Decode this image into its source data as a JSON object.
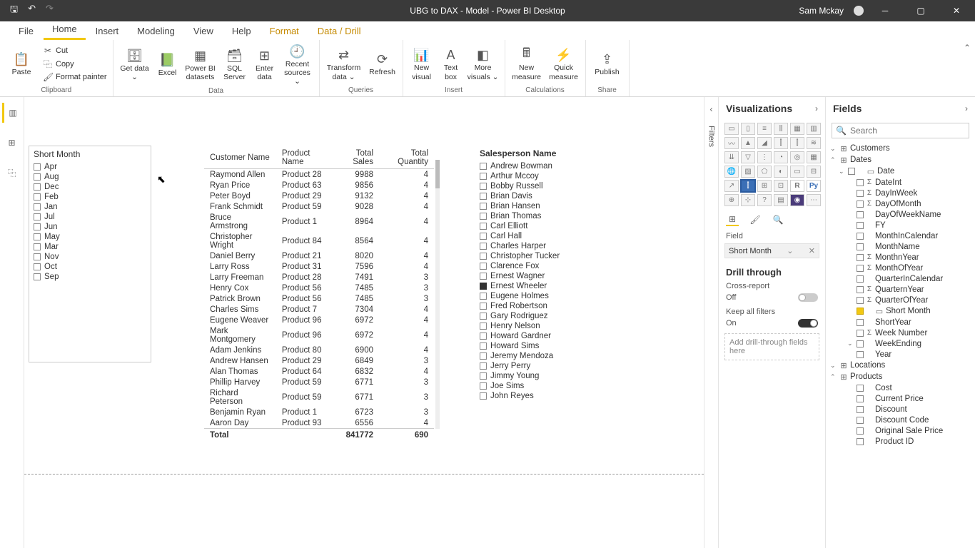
{
  "titlebar": {
    "title": "UBG to DAX - Model - Power BI Desktop",
    "user": "Sam Mckay"
  },
  "menu": {
    "file": "File",
    "home": "Home",
    "insert": "Insert",
    "modeling": "Modeling",
    "view": "View",
    "help": "Help",
    "format": "Format",
    "datadrill": "Data / Drill"
  },
  "ribbon": {
    "clipboard": {
      "label": "Clipboard",
      "paste": "Paste",
      "cut": "Cut",
      "copy": "Copy",
      "painter": "Format painter"
    },
    "data": {
      "label": "Data",
      "getdata": "Get data ⌄",
      "excel": "Excel",
      "pbids": "Power BI datasets",
      "sql": "SQL Server",
      "enter": "Enter data",
      "recent": "Recent sources ⌄"
    },
    "queries": {
      "label": "Queries",
      "transform": "Transform data ⌄",
      "refresh": "Refresh"
    },
    "insert": {
      "label": "Insert",
      "newvisual": "New visual",
      "textbox": "Text box",
      "more": "More visuals ⌄"
    },
    "calc": {
      "label": "Calculations",
      "newmeasure": "New measure",
      "quick": "Quick measure"
    },
    "share": {
      "label": "Share",
      "publish": "Publish"
    }
  },
  "slicer_months": {
    "title": "Short Month",
    "items": [
      "Apr",
      "Aug",
      "Dec",
      "Feb",
      "Jan",
      "Jul",
      "Jun",
      "May",
      "Mar",
      "Nov",
      "Oct",
      "Sep"
    ]
  },
  "table": {
    "cols": [
      "Customer Name",
      "Product Name",
      "Total Sales",
      "Total Quantity"
    ],
    "rows": [
      [
        "Raymond Allen",
        "Product 28",
        "9988",
        "4"
      ],
      [
        "Ryan Price",
        "Product 63",
        "9856",
        "4"
      ],
      [
        "Peter Boyd",
        "Product 29",
        "9132",
        "4"
      ],
      [
        "Frank Schmidt",
        "Product 59",
        "9028",
        "4"
      ],
      [
        "Bruce Armstrong",
        "Product 1",
        "8964",
        "4"
      ],
      [
        "Christopher Wright",
        "Product 84",
        "8564",
        "4"
      ],
      [
        "Daniel Berry",
        "Product 21",
        "8020",
        "4"
      ],
      [
        "Larry Ross",
        "Product 31",
        "7596",
        "4"
      ],
      [
        "Larry Freeman",
        "Product 28",
        "7491",
        "3"
      ],
      [
        "Henry Cox",
        "Product 56",
        "7485",
        "3"
      ],
      [
        "Patrick Brown",
        "Product 56",
        "7485",
        "3"
      ],
      [
        "Charles Sims",
        "Product 7",
        "7304",
        "4"
      ],
      [
        "Eugene Weaver",
        "Product 96",
        "6972",
        "4"
      ],
      [
        "Mark Montgomery",
        "Product 96",
        "6972",
        "4"
      ],
      [
        "Adam Jenkins",
        "Product 80",
        "6900",
        "4"
      ],
      [
        "Andrew Hansen",
        "Product 29",
        "6849",
        "3"
      ],
      [
        "Alan Thomas",
        "Product 64",
        "6832",
        "4"
      ],
      [
        "Phillip Harvey",
        "Product 59",
        "6771",
        "3"
      ],
      [
        "Richard Peterson",
        "Product 59",
        "6771",
        "3"
      ],
      [
        "Benjamin Ryan",
        "Product 1",
        "6723",
        "3"
      ],
      [
        "Aaron Day",
        "Product 93",
        "6556",
        "4"
      ]
    ],
    "total_label": "Total",
    "total_sales": "841772",
    "total_qty": "690"
  },
  "slicer_sales": {
    "title": "Salesperson Name",
    "items": [
      "Andrew Bowman",
      "Arthur Mccoy",
      "Bobby Russell",
      "Brian Davis",
      "Brian Hansen",
      "Brian Thomas",
      "Carl Elliott",
      "Carl Hall",
      "Charles Harper",
      "Christopher Tucker",
      "Clarence Fox",
      "Ernest Wagner",
      "Ernest Wheeler",
      "Eugene Holmes",
      "Fred Robertson",
      "Gary Rodriguez",
      "Henry Nelson",
      "Howard Gardner",
      "Howard Sims",
      "Jeremy Mendoza",
      "Jerry Perry",
      "Jimmy Young",
      "Joe Sims",
      "John Reyes"
    ],
    "selected_index": 12
  },
  "filters_label": "Filters",
  "viz": {
    "title": "Visualizations",
    "field_label": "Field",
    "field_value": "Short Month",
    "drill_title": "Drill through",
    "cross": "Cross-report",
    "off": "Off",
    "keep": "Keep all filters",
    "on": "On",
    "drill_well": "Add drill-through fields here"
  },
  "fields": {
    "title": "Fields",
    "search": "Search",
    "tables": {
      "customers": "Customers",
      "dates": "Dates",
      "date": "Date",
      "locations": "Locations",
      "products": "Products"
    },
    "date_fields": [
      "DateInt",
      "DayInWeek",
      "DayOfMonth",
      "DayOfWeekName",
      "FY",
      "MonthInCalendar",
      "MonthName",
      "MonthnYear",
      "MonthOfYear",
      "QuarterInCalendar",
      "QuarternYear",
      "QuarterOfYear",
      "Short Month",
      "ShortYear",
      "Week Number",
      "WeekEnding",
      "Year"
    ],
    "date_sigma": [
      true,
      true,
      true,
      false,
      false,
      false,
      false,
      true,
      true,
      false,
      true,
      true,
      false,
      false,
      true,
      false,
      false
    ],
    "date_selected_index": 12,
    "product_fields": [
      "Cost",
      "Current Price",
      "Discount",
      "Discount Code",
      "Original Sale Price",
      "Product ID"
    ]
  }
}
